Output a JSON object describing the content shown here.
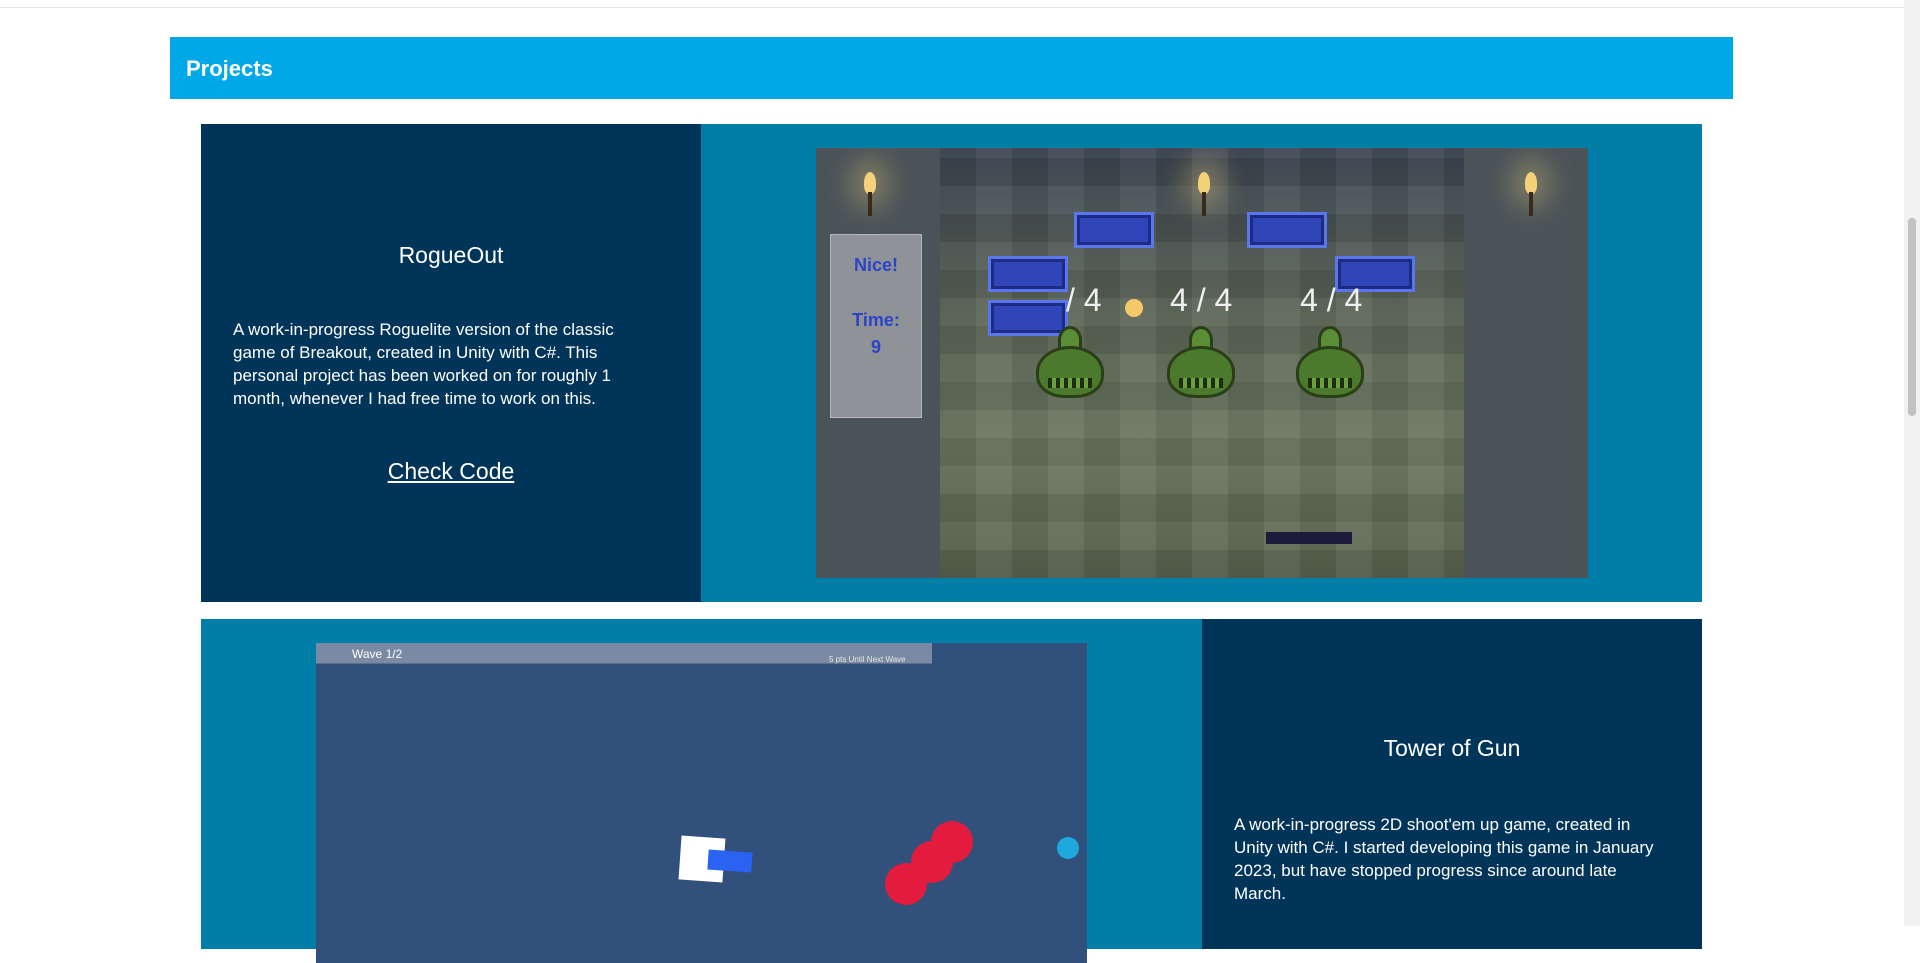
{
  "section": {
    "title": "Projects"
  },
  "projects": [
    {
      "title": "RogueOut",
      "description": "A work-in-progress Roguelite version of the classic game of Breakout, created in Unity with C#. This personal project has been worked on for roughly 1 month, whenever I had free time to work on this.",
      "link_label": "Check Code",
      "screenshot": {
        "panel_nice": "Nice!",
        "panel_time": "Time:\n9",
        "hp_labels": [
          "/ 4",
          "4 / 4",
          "4 / 4"
        ]
      }
    },
    {
      "title": "Tower of Gun",
      "description": "A work-in-progress 2D shoot'em up game, created in Unity with C#. I started developing this game in January 2023, but have stopped progress since around late March.",
      "screenshot": {
        "wave_label": "Wave 1/2",
        "points_label": "5 pts Until Next Wave"
      }
    }
  ],
  "colors": {
    "header": "#00a8e8",
    "card": "#007ea7",
    "text_pane": "#003459"
  }
}
